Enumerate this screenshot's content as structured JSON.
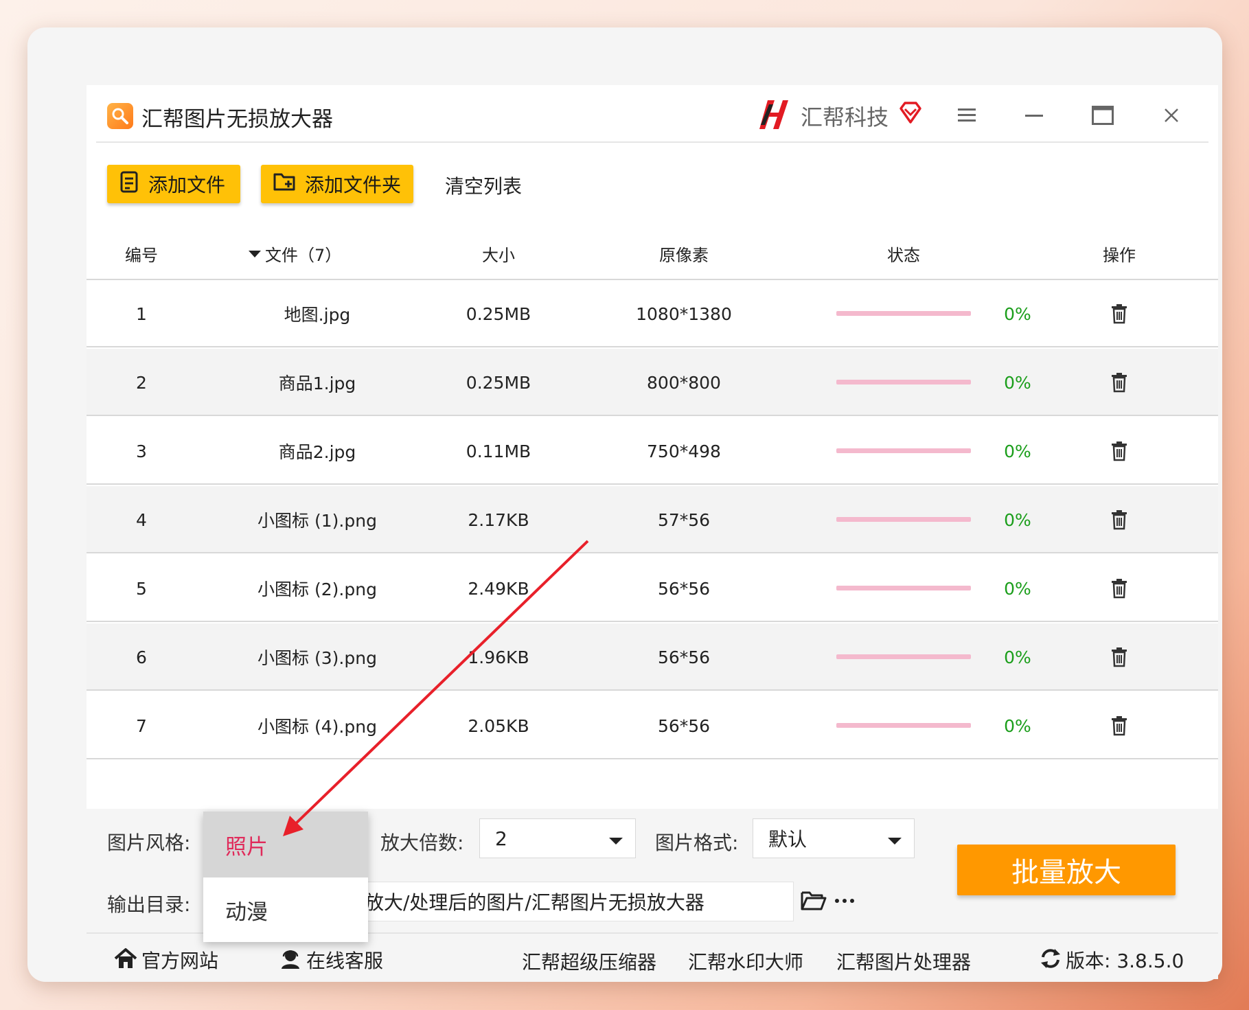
{
  "app": {
    "title": "汇帮图片无损放大器",
    "brand": "汇帮科技",
    "icons": {
      "app": "magnifier-icon",
      "brand_logo": "huibang-logo",
      "vip": "diamond-icon",
      "menu": "menu-icon",
      "minimize": "minimize-icon",
      "maximize": "maximize-icon",
      "close": "close-icon"
    }
  },
  "toolbar": {
    "add_file": "添加文件",
    "add_folder": "添加文件夹",
    "clear_list": "清空列表"
  },
  "table": {
    "headers": {
      "index": "编号",
      "file": "文件（7）",
      "size": "大小",
      "pixels": "原像素",
      "status": "状态",
      "action": "操作"
    },
    "rows": [
      {
        "index": "1",
        "file": "地图.jpg",
        "size": "0.25MB",
        "pixels": "1080*1380",
        "progress": 0,
        "progress_text": "0%"
      },
      {
        "index": "2",
        "file": "商品1.jpg",
        "size": "0.25MB",
        "pixels": "800*800",
        "progress": 0,
        "progress_text": "0%"
      },
      {
        "index": "3",
        "file": "商品2.jpg",
        "size": "0.11MB",
        "pixels": "750*498",
        "progress": 0,
        "progress_text": "0%"
      },
      {
        "index": "4",
        "file": "小图标 (1).png",
        "size": "2.17KB",
        "pixels": "57*56",
        "progress": 0,
        "progress_text": "0%"
      },
      {
        "index": "5",
        "file": "小图标 (2).png",
        "size": "2.49KB",
        "pixels": "56*56",
        "progress": 0,
        "progress_text": "0%"
      },
      {
        "index": "6",
        "file": "小图标 (3).png",
        "size": "1.96KB",
        "pixels": "56*56",
        "progress": 0,
        "progress_text": "0%"
      },
      {
        "index": "7",
        "file": "小图标 (4).png",
        "size": "2.05KB",
        "pixels": "56*56",
        "progress": 0,
        "progress_text": "0%"
      }
    ]
  },
  "settings": {
    "style_label": "图片风格:",
    "style_options": [
      "照片",
      "动漫"
    ],
    "style_selected": "照片",
    "scale_label": "放大倍数:",
    "scale_value": "2",
    "format_label": "图片格式:",
    "format_value": "默认",
    "output_label": "输出目录:",
    "output_path": "放大/处理后的图片/汇帮图片无损放大器",
    "run_button": "批量放大"
  },
  "footer": {
    "website": "官方网站",
    "support": "在线客服",
    "links": [
      "汇帮超级压缩器",
      "汇帮水印大师",
      "汇帮图片处理器"
    ],
    "version": "版本: 3.8.5.0"
  },
  "colors": {
    "accent_yellow": "#ffc107",
    "accent_orange": "#ff9800",
    "progress_pink": "#f4b9cd",
    "percent_green": "#1b9e1b",
    "selected_red": "#e02a5a",
    "arrow_red": "#e8202a"
  }
}
